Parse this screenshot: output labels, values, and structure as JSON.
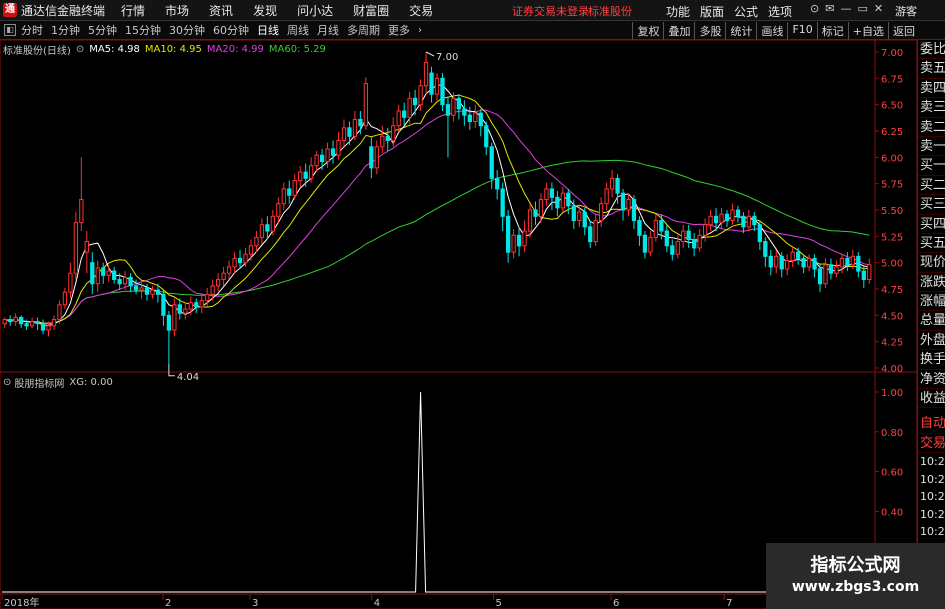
{
  "app": {
    "title": "通达信金融终端",
    "logo": "通"
  },
  "menus": [
    "行情",
    "市场",
    "资讯",
    "发现",
    "问小达",
    "财富圈",
    "交易"
  ],
  "status": {
    "login": "证券交易未登录",
    "stock": "标准股份"
  },
  "right_menus": [
    "功能",
    "版面",
    "公式",
    "选项"
  ],
  "window_icons": [
    "ring-icon",
    "mail-icon",
    "minimize-icon",
    "restore-icon",
    "close-icon"
  ],
  "window_icon_glyphs": [
    "⊙",
    "✉",
    "—",
    "▭",
    "✕"
  ],
  "guest": "游客",
  "periods": [
    "分时",
    "1分钟",
    "5分钟",
    "15分钟",
    "30分钟",
    "60分钟",
    "日线",
    "周线",
    "月线",
    "多周期",
    "更多"
  ],
  "active_period": "日线",
  "tool_buttons": [
    "复权",
    "叠加",
    "多股",
    "统计",
    "画线",
    "F10",
    "标记",
    "+自选",
    "返回"
  ],
  "legend": {
    "stock": "标准股份(日线)",
    "ma5": "MA5: 4.98",
    "ma10": "MA10: 4.95",
    "ma20": "MA20: 4.99",
    "ma60": "MA60: 5.29"
  },
  "indicator": {
    "name": "股朋指标网",
    "xg": "XG: 0.00"
  },
  "colors": {
    "up": "#ff3232",
    "down": "#00e5e5",
    "ma5": "#ffffff",
    "ma10": "#e6e600",
    "ma20": "#e040e0",
    "ma60": "#30d030",
    "axis": "#8a1010"
  },
  "side": [
    "委比",
    "卖五",
    "卖四",
    "卖三",
    "卖二",
    "卖一",
    "买一",
    "买二",
    "买三",
    "买四",
    "买五",
    "现价",
    "涨跌",
    "涨幅",
    "总量",
    "外盘",
    "换手",
    "净资",
    "收益"
  ],
  "side2": [
    "自动",
    "交易"
  ],
  "times": [
    "10:20",
    "10:20",
    "10:20",
    "10:21",
    "10:21",
    "10:21",
    "10:21",
    "10:21"
  ],
  "watermark": {
    "title": "指标公式网",
    "url": "www.zbgs3.com"
  },
  "chart_data": {
    "type": "candlestick",
    "ylim": [
      4.0,
      7.0
    ],
    "price_ticks": [
      "7.00",
      "6.75",
      "6.50",
      "6.25",
      "6.00",
      "5.75",
      "5.50",
      "5.25",
      "5.00",
      "4.75",
      "4.50",
      "4.25",
      "4.00"
    ],
    "indicator_ticks": [
      "1.00",
      "0.80",
      "0.60",
      "0.40"
    ],
    "x_labels": [
      "2018年",
      "2",
      "3",
      "4",
      "5",
      "6",
      "7"
    ],
    "high_label": "7.00",
    "low_label": "4.04",
    "candles": [
      [
        4.42,
        4.46,
        4.38,
        4.48
      ],
      [
        4.46,
        4.44,
        4.4,
        4.5
      ],
      [
        4.44,
        4.48,
        4.4,
        4.52
      ],
      [
        4.48,
        4.42,
        4.38,
        4.5
      ],
      [
        4.42,
        4.4,
        4.36,
        4.46
      ],
      [
        4.4,
        4.44,
        4.38,
        4.48
      ],
      [
        4.44,
        4.42,
        4.36,
        4.48
      ],
      [
        4.42,
        4.36,
        4.32,
        4.46
      ],
      [
        4.36,
        4.4,
        4.3,
        4.44
      ],
      [
        4.4,
        4.46,
        4.36,
        4.5
      ],
      [
        4.46,
        4.6,
        4.42,
        4.64
      ],
      [
        4.6,
        4.72,
        4.56,
        4.76
      ],
      [
        4.72,
        4.9,
        4.66,
        5.0
      ],
      [
        4.9,
        5.38,
        4.84,
        5.48
      ],
      [
        5.38,
        5.6,
        5.3,
        6.0
      ],
      [
        5.1,
        5.2,
        4.9,
        5.3
      ],
      [
        5.0,
        4.8,
        4.7,
        5.1
      ],
      [
        4.8,
        4.95,
        4.72,
        5.02
      ],
      [
        4.95,
        4.88,
        4.8,
        5.0
      ],
      [
        4.88,
        4.92,
        4.82,
        4.98
      ],
      [
        4.92,
        4.84,
        4.8,
        4.96
      ],
      [
        4.84,
        4.8,
        4.74,
        4.9
      ],
      [
        4.8,
        4.86,
        4.74,
        4.92
      ],
      [
        4.86,
        4.78,
        4.72,
        4.9
      ],
      [
        4.78,
        4.74,
        4.7,
        4.84
      ],
      [
        4.74,
        4.76,
        4.66,
        4.82
      ],
      [
        4.76,
        4.7,
        4.64,
        4.8
      ],
      [
        4.7,
        4.74,
        4.66,
        4.78
      ],
      [
        4.74,
        4.7,
        4.62,
        4.8
      ],
      [
        4.7,
        4.5,
        4.4,
        4.74
      ],
      [
        4.5,
        4.36,
        4.04,
        4.54
      ],
      [
        4.36,
        4.6,
        4.3,
        4.66
      ],
      [
        4.6,
        4.52,
        4.46,
        4.66
      ],
      [
        4.52,
        4.56,
        4.46,
        4.62
      ],
      [
        4.56,
        4.62,
        4.5,
        4.68
      ],
      [
        4.62,
        4.58,
        4.52,
        4.66
      ],
      [
        4.58,
        4.64,
        4.52,
        4.7
      ],
      [
        4.64,
        4.7,
        4.58,
        4.76
      ],
      [
        4.7,
        4.78,
        4.64,
        4.84
      ],
      [
        4.78,
        4.84,
        4.72,
        4.9
      ],
      [
        4.84,
        4.9,
        4.78,
        4.96
      ],
      [
        4.9,
        4.96,
        4.84,
        5.02
      ],
      [
        4.96,
        5.04,
        4.9,
        5.1
      ],
      [
        5.04,
        5.0,
        4.94,
        5.12
      ],
      [
        5.0,
        5.08,
        4.96,
        5.14
      ],
      [
        5.08,
        5.16,
        5.02,
        5.22
      ],
      [
        5.16,
        5.24,
        5.1,
        5.3
      ],
      [
        5.24,
        5.36,
        5.18,
        5.42
      ],
      [
        5.36,
        5.3,
        5.22,
        5.44
      ],
      [
        5.3,
        5.44,
        5.26,
        5.5
      ],
      [
        5.44,
        5.56,
        5.38,
        5.62
      ],
      [
        5.56,
        5.7,
        5.5,
        5.76
      ],
      [
        5.7,
        5.64,
        5.56,
        5.78
      ],
      [
        5.64,
        5.78,
        5.6,
        5.84
      ],
      [
        5.78,
        5.86,
        5.72,
        5.92
      ],
      [
        5.86,
        5.8,
        5.72,
        5.94
      ],
      [
        5.8,
        5.92,
        5.76,
        6.0
      ],
      [
        5.92,
        6.02,
        5.86,
        6.06
      ],
      [
        6.02,
        5.96,
        5.88,
        6.08
      ],
      [
        5.96,
        6.08,
        5.9,
        6.14
      ],
      [
        6.08,
        6.02,
        5.94,
        6.16
      ],
      [
        6.02,
        6.16,
        5.98,
        6.24
      ],
      [
        6.16,
        6.28,
        6.1,
        6.36
      ],
      [
        6.28,
        6.2,
        6.12,
        6.34
      ],
      [
        6.2,
        6.36,
        6.16,
        6.44
      ],
      [
        6.36,
        6.3,
        6.22,
        6.44
      ],
      [
        6.3,
        6.7,
        6.26,
        6.76
      ],
      [
        6.1,
        5.9,
        5.8,
        6.2
      ],
      [
        5.9,
        6.1,
        5.84,
        6.16
      ],
      [
        6.1,
        6.2,
        6.04,
        6.3
      ],
      [
        6.2,
        6.16,
        6.06,
        6.28
      ],
      [
        6.16,
        6.3,
        6.1,
        6.38
      ],
      [
        6.3,
        6.44,
        6.24,
        6.5
      ],
      [
        6.44,
        6.38,
        6.3,
        6.52
      ],
      [
        6.38,
        6.56,
        6.32,
        6.62
      ],
      [
        6.56,
        6.5,
        6.4,
        6.64
      ],
      [
        6.5,
        6.68,
        6.44,
        6.74
      ],
      [
        6.68,
        6.9,
        6.6,
        7.0
      ],
      [
        6.8,
        6.6,
        6.52,
        6.86
      ],
      [
        6.6,
        6.75,
        6.54,
        6.8
      ],
      [
        6.75,
        6.5,
        6.44,
        6.8
      ],
      [
        6.5,
        6.4,
        6.0,
        6.58
      ],
      [
        6.4,
        6.56,
        6.34,
        6.62
      ],
      [
        6.56,
        6.46,
        6.36,
        6.6
      ],
      [
        6.46,
        6.4,
        6.3,
        6.54
      ],
      [
        6.4,
        6.34,
        6.26,
        6.48
      ],
      [
        6.34,
        6.42,
        6.28,
        6.5
      ],
      [
        6.42,
        6.3,
        6.2,
        6.46
      ],
      [
        6.3,
        6.1,
        6.02,
        6.34
      ],
      [
        6.1,
        5.8,
        5.7,
        6.14
      ],
      [
        5.8,
        5.7,
        5.6,
        5.88
      ],
      [
        5.7,
        5.44,
        5.3,
        5.76
      ],
      [
        5.44,
        5.1,
        5.0,
        5.5
      ],
      [
        5.1,
        5.26,
        5.04,
        5.32
      ],
      [
        5.26,
        5.16,
        5.06,
        5.34
      ],
      [
        5.16,
        5.3,
        5.1,
        5.4
      ],
      [
        5.3,
        5.5,
        5.24,
        5.56
      ],
      [
        5.5,
        5.44,
        5.36,
        5.58
      ],
      [
        5.44,
        5.6,
        5.38,
        5.66
      ],
      [
        5.6,
        5.7,
        5.54,
        5.76
      ],
      [
        5.7,
        5.62,
        5.5,
        5.76
      ],
      [
        5.62,
        5.52,
        5.44,
        5.68
      ],
      [
        5.52,
        5.66,
        5.48,
        5.72
      ],
      [
        5.66,
        5.54,
        5.46,
        5.7
      ],
      [
        5.54,
        5.4,
        5.32,
        5.6
      ],
      [
        5.4,
        5.48,
        5.34,
        5.54
      ],
      [
        5.48,
        5.34,
        5.26,
        5.52
      ],
      [
        5.34,
        5.2,
        5.14,
        5.4
      ],
      [
        5.2,
        5.4,
        5.16,
        5.46
      ],
      [
        5.4,
        5.56,
        5.34,
        5.62
      ],
      [
        5.56,
        5.7,
        5.5,
        5.76
      ],
      [
        5.7,
        5.8,
        5.62,
        5.88
      ],
      [
        5.8,
        5.66,
        5.56,
        5.84
      ],
      [
        5.66,
        5.5,
        5.4,
        5.7
      ],
      [
        5.5,
        5.6,
        5.44,
        5.66
      ],
      [
        5.6,
        5.4,
        5.32,
        5.64
      ],
      [
        5.4,
        5.26,
        5.16,
        5.44
      ],
      [
        5.26,
        5.1,
        5.04,
        5.3
      ],
      [
        5.1,
        5.24,
        5.06,
        5.3
      ],
      [
        5.24,
        5.4,
        5.2,
        5.46
      ],
      [
        5.4,
        5.3,
        5.22,
        5.46
      ],
      [
        5.3,
        5.16,
        5.1,
        5.36
      ],
      [
        5.16,
        5.08,
        5.02,
        5.22
      ],
      [
        5.08,
        5.2,
        5.04,
        5.26
      ],
      [
        5.2,
        5.3,
        5.14,
        5.36
      ],
      [
        5.3,
        5.22,
        5.14,
        5.36
      ],
      [
        5.22,
        5.14,
        5.06,
        5.28
      ],
      [
        5.14,
        5.26,
        5.1,
        5.32
      ],
      [
        5.26,
        5.36,
        5.2,
        5.42
      ],
      [
        5.36,
        5.44,
        5.3,
        5.5
      ],
      [
        5.44,
        5.38,
        5.3,
        5.52
      ],
      [
        5.38,
        5.46,
        5.32,
        5.52
      ],
      [
        5.46,
        5.4,
        5.34,
        5.5
      ],
      [
        5.4,
        5.5,
        5.36,
        5.56
      ],
      [
        5.5,
        5.44,
        5.38,
        5.54
      ],
      [
        5.44,
        5.34,
        5.28,
        5.48
      ],
      [
        5.34,
        5.44,
        5.3,
        5.5
      ],
      [
        5.44,
        5.36,
        5.3,
        5.48
      ],
      [
        5.36,
        5.2,
        5.12,
        5.4
      ],
      [
        5.2,
        5.06,
        4.96,
        5.24
      ],
      [
        5.06,
        4.96,
        4.88,
        5.12
      ],
      [
        4.96,
        5.06,
        4.9,
        5.12
      ],
      [
        5.06,
        4.94,
        4.86,
        5.1
      ],
      [
        4.94,
        5.02,
        4.88,
        5.08
      ],
      [
        5.02,
        5.1,
        4.96,
        5.14
      ],
      [
        5.1,
        5.04,
        4.98,
        5.14
      ],
      [
        5.04,
        4.96,
        4.9,
        5.08
      ],
      [
        4.96,
        5.04,
        4.92,
        5.08
      ],
      [
        5.04,
        4.94,
        4.86,
        5.08
      ],
      [
        4.94,
        4.8,
        4.72,
        4.98
      ],
      [
        4.8,
        4.98,
        4.76,
        5.04
      ],
      [
        4.98,
        4.9,
        4.84,
        5.04
      ],
      [
        4.9,
        4.96,
        4.86,
        5.02
      ],
      [
        4.96,
        5.04,
        4.9,
        5.08
      ],
      [
        5.04,
        4.98,
        4.92,
        5.1
      ],
      [
        4.98,
        5.06,
        4.94,
        5.12
      ],
      [
        5.06,
        4.92,
        4.86,
        5.1
      ],
      [
        4.92,
        4.84,
        4.76,
        4.96
      ],
      [
        4.84,
        4.98,
        4.8,
        5.04
      ]
    ],
    "signal": {
      "index": 76,
      "value": 1.0
    }
  }
}
